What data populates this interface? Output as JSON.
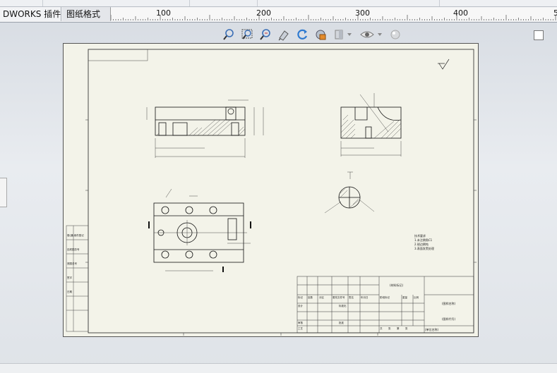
{
  "tabs": [
    {
      "label": "DWORKS 插件",
      "active": false
    },
    {
      "label": "图纸格式",
      "active": true
    }
  ],
  "ruler": {
    "labels": [
      "100",
      "200",
      "300",
      "400",
      "5"
    ]
  },
  "view_toolbar": {
    "icons": [
      "zoom-to-fit-icon",
      "zoom-to-area-icon",
      "zoom-in-out-icon",
      "rotate-view-icon",
      "redraw-icon",
      "display-style-icon",
      "section-view-icon",
      "hide-show-icon",
      "appearance-icon"
    ]
  },
  "drawing": {
    "title_note": "技术要求",
    "notes": [
      "1.未注倒角C1",
      "2.锐边倒钝",
      "3.表面发黑处理"
    ],
    "title_block": {
      "part_name": "(材料标记)",
      "company": "(单位名称)",
      "drawing_name": "(图样名称)",
      "code": "(图样代号)",
      "row_labels": [
        "标记",
        "处数",
        "分区",
        "更改文件号",
        "签名",
        "年月日"
      ],
      "row_labels2": [
        "设计",
        "审核",
        "工艺",
        "标准化",
        "批准"
      ],
      "scale_labels": [
        "阶段标记",
        "重量",
        "比例"
      ],
      "sheet_labels": [
        "共",
        "张",
        "第",
        "张"
      ]
    },
    "left_strip": [
      "借(通)用件登记",
      "旧底图总号",
      "底图总号",
      "签字",
      "日期"
    ]
  }
}
